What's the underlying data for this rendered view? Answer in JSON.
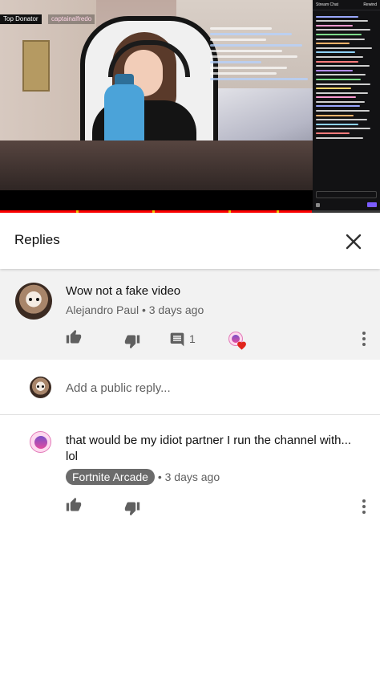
{
  "player": {
    "overlay_label": "Top Donator",
    "overlay_user": "captainalfredo",
    "chat_title": "Stream Chat",
    "chat_action": "Rewind",
    "progress_fraction": 0.82,
    "accent": "#ff0000"
  },
  "replies": {
    "title": "Replies"
  },
  "parent_comment": {
    "text": "Wow not a fake video",
    "author": "Alejandro Paul",
    "time": "3 days ago",
    "reply_count": "1"
  },
  "add_reply": {
    "placeholder": "Add a public reply..."
  },
  "reply": {
    "text": "that would be my idiot partner I run the channel with... lol",
    "author": "Fortnite Arcade",
    "time": "3 days ago"
  },
  "icons": [
    "close-icon",
    "thumbs-up-icon",
    "thumbs-down-icon",
    "reply-icon",
    "more-vert-icon",
    "heart-icon"
  ]
}
